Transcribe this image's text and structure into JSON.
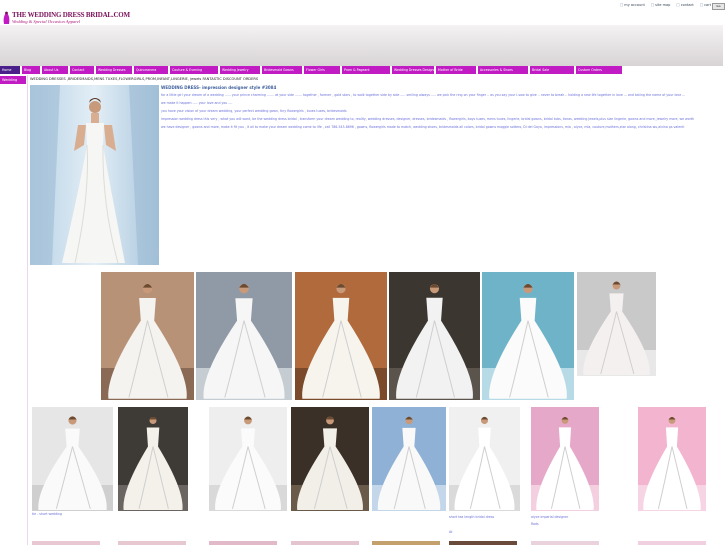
{
  "header": {
    "logo_main": "THE WEDDING DRESS BRIDAL.COM",
    "logo_sub": "Wedding & Special Occasion Apparel",
    "top_links": [
      "my account",
      "site map",
      "contact",
      "cart"
    ],
    "search_button": "Go"
  },
  "nav": {
    "items": [
      "Home",
      "Blog",
      "About Us",
      "Contact",
      "Wedding Dresses",
      "Quinceanera",
      "Couture & Evening",
      "Wedding Jewelry",
      "Bridesmaid Gowns",
      "Flower Girls",
      "Prom & Pageant",
      "Wedding Dresses Designer",
      "Mother of Bride",
      "Accessories & Shoes",
      "Bridal Sale",
      "Custom Orders"
    ],
    "active_index": 0,
    "sub_left": "Wedding",
    "sub_line": "WEDDING DRESSES ,BRIDESMAIDS,MENS TUXES,FLOWERGIRLS,PROM,INFANT,LINGERIE, jewels FANTASTIC DISCOUNT ORDERS"
  },
  "main": {
    "title": "WEDDING DRESS- impression designer style #3084",
    "paragraphs": [
      "for a little girl your dream of a wedding ...... your prince charming ....... at your side ....... together , forever , gold stars , to walk together side by side ..... smiling always ..... we pick the ring on your finger .. as you say your I-vow to give .. never to break .. holding a new life together in love ... and taking the name of your love ...",
      "we make it happen ..... your love and you ....",
      "you have your vision of your dream wedding, your perfect wedding gown, tiny flowergirls , tuxes tuxes, bridesmaids",
      "impression wedding dress this very , what you will want, be the wedding dress bridal , transform your dream wedding to, reality, wedding dresses, designer, dresses, bridesmaids , flowergirls, boys tuxes, mens tuxes, lingerie, bridal gowns, bridal tubs, tiaras, wedding jewels,plus size lingerie, gowns and more, jewelry more, we worth",
      "we have designer , gowns and more, make it fit you , it all to make your dream wedding come to life , call 786-543-8696 , gowns, flowergirls made to match, wedding shoes, bridesmaids all colors, bridal gowns maggie sottero, Di del Gayo, impressions, mia , alyce, mia, couture,mothers,star along, christina wu,alvina ps valenti"
    ]
  },
  "gallery_row2_captions": {
    "left": "tie - short wedding",
    "right_main": "short tea length bridal dress",
    "right_sub": "At",
    "far_main": "alyce imperial designer",
    "far_sub": "Rods"
  },
  "colors": {
    "nav_bg": "#c11bc4",
    "nav_active": "#4a1f8a",
    "link_text": "#6a6fd8",
    "title_text": "#3e5f9c"
  }
}
